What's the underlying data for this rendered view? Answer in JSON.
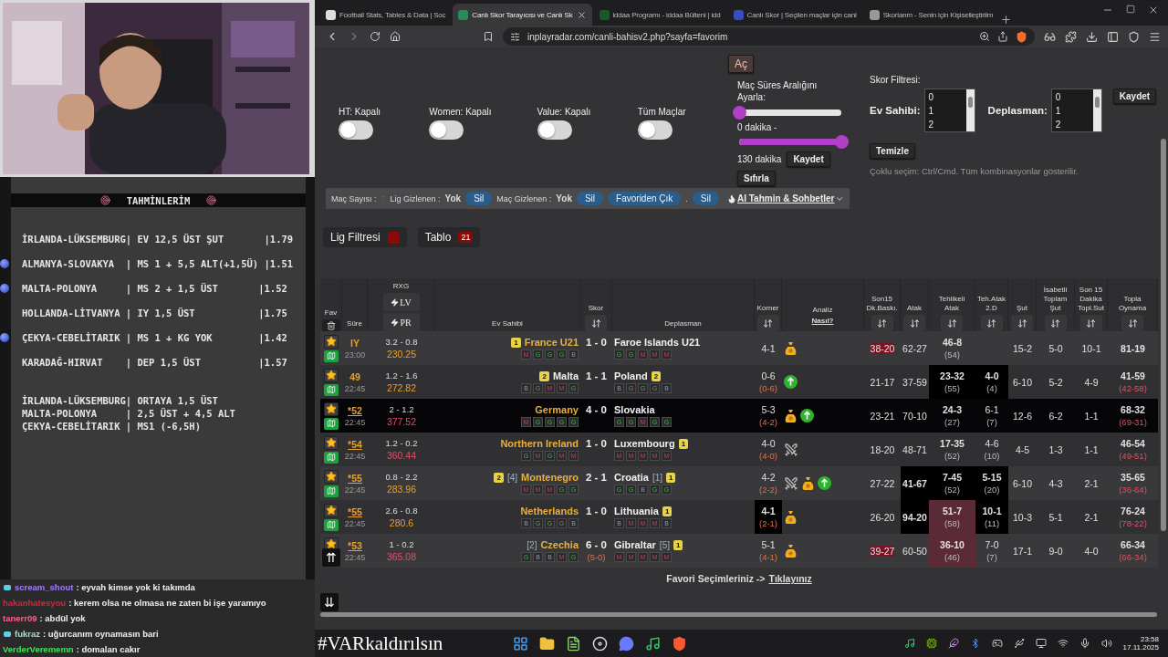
{
  "predictions": {
    "title": "TAHMİNLERİM",
    "lines": [
      {
        "text": "İRLANDA-LÜKSEMBURG| EV 12,5 ÜST ŞUT       |1.79",
        "marked": false
      },
      {
        "text": "ALMANYA-SLOVAKYA  | MS 1 + 5,5 ALT(+1,5Ü) |1.51",
        "marked": true
      },
      {
        "text": "MALTA-POLONYA     | MS 2 + 1,5 ÜST       |1.52",
        "marked": true
      },
      {
        "text": "HOLLANDA-LİTVANYA | IY 1,5 ÜST           |1.75",
        "marked": false
      },
      {
        "text": "ÇEKYA-CEBELİTARIK | MS 1 + KG YOK        |1.42",
        "marked": true
      },
      {
        "text": "KARADAĞ-HIRVAT    | DEP 1,5 ÜST          |1.57",
        "marked": false
      }
    ],
    "extra_lines": [
      "İRLANDA-LÜKSEMBURG| ORTAYA 1,5 ÜST",
      "MALTA-POLONYA     | 2,5 ÜST + 4,5 ALT",
      "ÇEKYA-CEBELİTARIK | MS1 (-6,5H)"
    ]
  },
  "chat": [
    {
      "user": "scream_shout",
      "color": "#a878ff",
      "message": ": eyvah kimse yok ki takımda",
      "badge": true
    },
    {
      "user": "hakanhatesyou",
      "color": "#e0203a",
      "message": ": kerem olsa ne olmasa ne zaten bi işe yaramıyo",
      "badge": false
    },
    {
      "user": "tanerr09",
      "color": "#ff6088",
      "message": ": abdül yok",
      "badge": false
    },
    {
      "user": "fukraz",
      "color": "#9fe0c0",
      "message": ": uğurcanım oynamasın bari",
      "badge": true
    },
    {
      "user": "VerderVerememn",
      "color": "#40e060",
      "message": ": domalan cakır",
      "badge": false
    }
  ],
  "browser": {
    "tabs": [
      {
        "title": "Football Stats, Tables & Data | Soc",
        "selected": false
      },
      {
        "title": "Canlı Skor Tarayıcısı ve Canlı Sk",
        "selected": true
      },
      {
        "title": "iddaa Programı - iddaa Bülteni | idd",
        "selected": false
      },
      {
        "title": "Canlı Skor | Seçilen maçlar için canl",
        "selected": false
      },
      {
        "title": "Skorlarım - Senin için Kişiselleştirilm",
        "selected": false
      }
    ],
    "url": "inplayradar.com/canli-bahisv2.php?sayfa=favorim"
  },
  "controls": {
    "open_button": "Aç",
    "toggles": [
      {
        "label": "HT: Kapalı",
        "on": false
      },
      {
        "label": "Women: Kapalı",
        "on": false
      },
      {
        "label": "Value: Kapalı",
        "on": false
      },
      {
        "label": "Tüm Maçlar",
        "on": false
      }
    ],
    "duration": {
      "label": "Maç Süres Aralığını Ayarla:",
      "min_slider": {
        "level": 0
      },
      "min_reading": "0 dakika -",
      "max_slider": {
        "level": 1
      },
      "max_reading": "130 dakika",
      "save": "Kaydet",
      "reset": "Sıfırla"
    },
    "score_filter": {
      "title": "Skor Filtresi:",
      "home_label": "Ev Sahibi:",
      "home_options": [
        "0",
        "1",
        "2"
      ],
      "away_label": "Deplasman:",
      "away_options": [
        "0",
        "1",
        "2"
      ],
      "save": "Kaydet",
      "clear": "Temizle",
      "hint": "Çoklu seçim: Ctrl/Cmd. Tüm kombinasyonlar gösterilir."
    }
  },
  "info_bar": [
    {
      "kind": "label",
      "text": "Maç Sayısı :"
    },
    {
      "kind": "count",
      "text": "7"
    },
    {
      "kind": "label",
      "text": "Lig Gizlenen :"
    },
    {
      "kind": "value",
      "text": "Yok"
    },
    {
      "kind": "pill",
      "text": "Sil"
    },
    {
      "kind": "label",
      "text": "Maç Gizlenen :"
    },
    {
      "kind": "value",
      "text": "Yok"
    },
    {
      "kind": "pill",
      "text": "Sil"
    },
    {
      "kind": "pill",
      "text": "Favoriden Çık"
    },
    {
      "kind": "label",
      "text": "."
    },
    {
      "kind": "pill",
      "text": "Sil"
    },
    {
      "kind": "menu",
      "text": "AI Tahmin & Sohbetler"
    }
  ],
  "filter_buttons": [
    {
      "label": "Lig Filtresi",
      "kind": "swatch"
    },
    {
      "label": "Tablo",
      "kind": "count",
      "count": "21"
    }
  ],
  "table": {
    "columns": [
      {
        "lines": [
          "Fav"
        ],
        "kind": "trash"
      },
      {
        "lines": [
          "Süre"
        ],
        "kind": "plain"
      },
      {
        "lines": [
          "RXG"
        ],
        "kind": "rxg",
        "buttons": [
          "LV",
          "PR"
        ]
      },
      {
        "lines": [
          "Ev Sahibi"
        ],
        "kind": "plain"
      },
      {
        "lines": [
          "Skor"
        ],
        "kind": "sort"
      },
      {
        "lines": [
          "Deplasman"
        ],
        "kind": "plain"
      },
      {
        "lines": [
          "Korner"
        ],
        "kind": "sort"
      },
      {
        "lines": [
          "Analiz"
        ],
        "kind": "link",
        "link": "Nasıl?"
      },
      {
        "lines": [
          "Son15",
          "Dk.Baskı."
        ],
        "kind": "sort"
      },
      {
        "lines": [
          "Atak"
        ],
        "kind": "sort"
      },
      {
        "lines": [
          "Tehlikeli",
          "Atak"
        ],
        "kind": "sort"
      },
      {
        "lines": [
          "Teh.Atak",
          "2.D"
        ],
        "kind": "sort"
      },
      {
        "lines": [
          "Şut"
        ],
        "kind": "sort"
      },
      {
        "lines": [
          "İsabetli",
          "Toplam",
          "Şut"
        ],
        "kind": "sort"
      },
      {
        "lines": [
          "Son 15",
          "Dakika",
          "Topl.Sut"
        ],
        "kind": "sort"
      },
      {
        "lines": [
          "Topla",
          "Oynama"
        ],
        "kind": "sort"
      }
    ],
    "rows": [
      {
        "minute": "IY",
        "minute_link": false,
        "time": "23:00",
        "rxg": "3.2 - 0.8",
        "rating": {
          "text": "230.25",
          "color": "#e8a030"
        },
        "highlighted": false,
        "home": {
          "name": "France U21",
          "favored": true,
          "badges": [
            {
              "kind": "rank",
              "text": "1"
            }
          ],
          "form": [
            {
              "r": "M",
              "kind": "loss"
            },
            {
              "r": "G",
              "kind": "win"
            },
            {
              "r": "G",
              "kind": "win"
            },
            {
              "r": "G",
              "kind": "win"
            },
            {
              "r": "B",
              "kind": "draw"
            }
          ]
        },
        "score": "1 - 0",
        "away": {
          "name": "Faroe Islands U21",
          "favored": false,
          "form": [
            {
              "r": "G",
              "kind": "win"
            },
            {
              "r": "G",
              "kind": "win"
            },
            {
              "r": "M",
              "kind": "loss"
            },
            {
              "r": "M",
              "kind": "loss"
            },
            {
              "r": "M",
              "kind": "loss"
            }
          ]
        },
        "corner": {
          "v": "4-1",
          "kind": "plain"
        },
        "analysis": [
          {
            "kind": "money"
          }
        ],
        "stats": [
          {
            "v": "38-20",
            "kind": "tag"
          },
          {
            "v": "62-27",
            "kind": "plain"
          },
          {
            "v": "46-8",
            "sub": "(54)",
            "kind": "plain"
          },
          {
            "kind": "plain"
          },
          {
            "v": "15-2",
            "kind": "plain"
          },
          {
            "v": "5-0",
            "kind": "plain"
          },
          {
            "v": "10-1",
            "kind": "plain"
          },
          {
            "v": "81-19",
            "kind": "plain"
          }
        ]
      },
      {
        "minute": "49",
        "minute_link": false,
        "time": "22:45",
        "rxg": "1.2 - 1.6",
        "rating": {
          "text": "272.82",
          "color": "#e8a030"
        },
        "highlighted": false,
        "home": {
          "name": "Malta",
          "favored": false,
          "badges": [
            {
              "kind": "rank",
              "text": "2"
            }
          ],
          "form": [
            {
              "r": "B",
              "kind": "draw"
            },
            {
              "r": "G",
              "kind": "win"
            },
            {
              "r": "M",
              "kind": "loss"
            },
            {
              "r": "M",
              "kind": "loss"
            },
            {
              "r": "G",
              "kind": "win"
            }
          ]
        },
        "score": "1 - 1",
        "away": {
          "name": "Poland",
          "favored": false,
          "badges": [
            {
              "kind": "rank",
              "text": "2"
            }
          ],
          "form": [
            {
              "r": "B",
              "kind": "draw"
            },
            {
              "r": "G",
              "kind": "win"
            },
            {
              "r": "G",
              "kind": "win"
            },
            {
              "r": "G",
              "kind": "win"
            },
            {
              "r": "B",
              "kind": "draw"
            }
          ]
        },
        "corner": {
          "v": "0-6",
          "sub": "(0-6)",
          "kind": "plain"
        },
        "analysis": [
          {
            "kind": "up"
          }
        ],
        "stats": [
          {
            "v": "21-17",
            "kind": "plain"
          },
          {
            "v": "37-59",
            "kind": "plain"
          },
          {
            "v": "23-32",
            "sub": "(55)",
            "kind": "dark"
          },
          {
            "v": "4-0",
            "sub": "(4)",
            "kind": "dark"
          },
          {
            "v": "6-10",
            "kind": "plain"
          },
          {
            "v": "5-2",
            "kind": "plain"
          },
          {
            "v": "4-9",
            "kind": "plain"
          },
          {
            "v": "41-59",
            "sub": "(42-58)",
            "kind": "plain"
          }
        ]
      },
      {
        "minute": "*52",
        "minute_link": true,
        "time": "22:45",
        "rxg": "2 - 1.2",
        "rating": {
          "text": "377.52",
          "color": "#e0506a"
        },
        "highlighted": true,
        "home": {
          "name": "Germany",
          "favored": true,
          "form": [
            {
              "r": "M",
              "kind": "loss"
            },
            {
              "r": "G",
              "kind": "win"
            },
            {
              "r": "G",
              "kind": "win"
            },
            {
              "r": "G",
              "kind": "win"
            },
            {
              "r": "G",
              "kind": "win"
            }
          ]
        },
        "score": "4 - 0",
        "away": {
          "name": "Slovakia",
          "favored": false,
          "form": [
            {
              "r": "G",
              "kind": "win"
            },
            {
              "r": "G",
              "kind": "win"
            },
            {
              "r": "M",
              "kind": "loss"
            },
            {
              "r": "G",
              "kind": "win"
            },
            {
              "r": "G",
              "kind": "win"
            }
          ]
        },
        "corner": {
          "v": "5-3",
          "sub": "(4-2)",
          "kind": "plain"
        },
        "analysis": [
          {
            "kind": "money"
          },
          {
            "kind": "up"
          }
        ],
        "stats": [
          {
            "v": "23-21",
            "kind": "plain"
          },
          {
            "v": "70-10",
            "kind": "plain"
          },
          {
            "v": "24-3",
            "sub": "(27)",
            "kind": "plain"
          },
          {
            "v": "6-1",
            "sub": "(7)",
            "kind": "plain"
          },
          {
            "v": "12-6",
            "kind": "plain"
          },
          {
            "v": "6-2",
            "kind": "plain"
          },
          {
            "v": "1-1",
            "kind": "plain"
          },
          {
            "v": "68-32",
            "sub": "(69-31)",
            "kind": "plain"
          }
        ]
      },
      {
        "minute": "*54",
        "minute_link": true,
        "time": "22:45",
        "rxg": "1.2 - 0.2",
        "rating": {
          "text": "360.44",
          "color": "#e0506a"
        },
        "highlighted": false,
        "home": {
          "name": "Northern Ireland",
          "favored": true,
          "form": [
            {
              "r": "G",
              "kind": "win"
            },
            {
              "r": "M",
              "kind": "loss"
            },
            {
              "r": "G",
              "kind": "win"
            },
            {
              "r": "M",
              "kind": "loss"
            },
            {
              "r": "M",
              "kind": "loss"
            }
          ]
        },
        "score": "1 - 0",
        "away": {
          "name": "Luxembourg",
          "favored": false,
          "badges": [
            {
              "kind": "rank",
              "text": "1"
            }
          ],
          "form": [
            {
              "r": "M",
              "kind": "loss"
            },
            {
              "r": "M",
              "kind": "loss"
            },
            {
              "r": "M",
              "kind": "loss"
            },
            {
              "r": "M",
              "kind": "loss"
            },
            {
              "r": "M",
              "kind": "loss"
            }
          ]
        },
        "corner": {
          "v": "4-0",
          "sub": "(4-0)",
          "kind": "plain"
        },
        "analysis": [
          {
            "kind": "swords"
          }
        ],
        "stats": [
          {
            "v": "18-20",
            "kind": "plain"
          },
          {
            "v": "48-71",
            "kind": "plain"
          },
          {
            "v": "17-35",
            "sub": "(52)",
            "kind": "plain"
          },
          {
            "v": "4-6",
            "sub": "(10)",
            "kind": "plain"
          },
          {
            "v": "4-5",
            "kind": "plain"
          },
          {
            "v": "1-3",
            "kind": "plain"
          },
          {
            "v": "1-1",
            "kind": "plain"
          },
          {
            "v": "46-54",
            "sub": "(49-51)",
            "kind": "plain"
          }
        ]
      },
      {
        "minute": "*55",
        "minute_link": true,
        "time": "22:45",
        "rxg": "0.8 - 2.2",
        "rating": {
          "text": "283.96",
          "color": "#e8a030"
        },
        "highlighted": false,
        "home": {
          "name": "Montenegro",
          "favored": true,
          "badges": [
            {
              "kind": "rank",
              "text": "2"
            },
            {
              "kind": "seed",
              "text": "[4]"
            }
          ],
          "form": [
            {
              "r": "M",
              "kind": "loss"
            },
            {
              "r": "M",
              "kind": "loss"
            },
            {
              "r": "M",
              "kind": "loss"
            },
            {
              "r": "G",
              "kind": "win"
            },
            {
              "r": "G",
              "kind": "win"
            }
          ]
        },
        "score": "2 - 1",
        "away": {
          "name": "Croatia",
          "favored": false,
          "badges": [
            {
              "kind": "seed",
              "text": "[1]"
            },
            {
              "kind": "rank",
              "text": "1"
            }
          ],
          "form": [
            {
              "r": "G",
              "kind": "win"
            },
            {
              "r": "G",
              "kind": "win"
            },
            {
              "r": "B",
              "kind": "draw"
            },
            {
              "r": "G",
              "kind": "win"
            },
            {
              "r": "G",
              "kind": "win"
            }
          ]
        },
        "corner": {
          "v": "4-2",
          "sub": "(2-2)",
          "kind": "plain"
        },
        "analysis": [
          {
            "kind": "swords"
          },
          {
            "kind": "money"
          },
          {
            "kind": "up"
          }
        ],
        "stats": [
          {
            "v": "27-22",
            "kind": "plain"
          },
          {
            "v": "41-67",
            "kind": "dark"
          },
          {
            "v": "7-45",
            "sub": "(52)",
            "kind": "dark"
          },
          {
            "v": "5-15",
            "sub": "(20)",
            "kind": "dark"
          },
          {
            "v": "6-10",
            "kind": "plain"
          },
          {
            "v": "4-3",
            "kind": "plain"
          },
          {
            "v": "2-1",
            "kind": "plain"
          },
          {
            "v": "35-65",
            "sub": "(36-64)",
            "kind": "plain"
          }
        ]
      },
      {
        "minute": "*55",
        "minute_link": true,
        "time": "22:45",
        "rxg": "2.6 - 0.8",
        "rating": {
          "text": "280.6",
          "color": "#e8a030"
        },
        "highlighted": false,
        "home": {
          "name": "Netherlands",
          "favored": true,
          "form": [
            {
              "r": "B",
              "kind": "draw"
            },
            {
              "r": "G",
              "kind": "win"
            },
            {
              "r": "G",
              "kind": "win"
            },
            {
              "r": "G",
              "kind": "win"
            },
            {
              "r": "B",
              "kind": "draw"
            }
          ]
        },
        "score": "1 - 0",
        "away": {
          "name": "Lithuania",
          "favored": false,
          "badges": [
            {
              "kind": "rank",
              "text": "1"
            }
          ],
          "form": [
            {
              "r": "B",
              "kind": "draw"
            },
            {
              "r": "M",
              "kind": "loss"
            },
            {
              "r": "M",
              "kind": "loss"
            },
            {
              "r": "M",
              "kind": "loss"
            },
            {
              "r": "B",
              "kind": "draw"
            }
          ]
        },
        "corner": {
          "v": "4-1",
          "sub": "(2-1)",
          "kind": "dark"
        },
        "analysis": [
          {
            "kind": "money"
          }
        ],
        "stats": [
          {
            "v": "26-20",
            "kind": "plain"
          },
          {
            "v": "94-20",
            "kind": "dark"
          },
          {
            "v": "51-7",
            "sub": "(58)",
            "kind": "red"
          },
          {
            "v": "10-1",
            "sub": "(11)",
            "kind": "dark"
          },
          {
            "v": "10-3",
            "kind": "plain"
          },
          {
            "v": "5-1",
            "kind": "plain"
          },
          {
            "v": "2-1",
            "kind": "plain"
          },
          {
            "v": "76-24",
            "sub": "(78-22)",
            "kind": "plain"
          }
        ]
      },
      {
        "minute": "*53",
        "minute_link": true,
        "time": "22:45",
        "rxg": "1 - 0.2",
        "rating": {
          "text": "365.08",
          "color": "#e0506a"
        },
        "highlighted": false,
        "home": {
          "name": "Czechia",
          "favored": true,
          "badges": [
            {
              "kind": "seed",
              "text": "[2]"
            }
          ],
          "form": [
            {
              "r": "G",
              "kind": "win"
            },
            {
              "r": "B",
              "kind": "draw"
            },
            {
              "r": "B",
              "kind": "draw"
            },
            {
              "r": "M",
              "kind": "loss"
            },
            {
              "r": "G",
              "kind": "win"
            }
          ]
        },
        "score": "6 - 0",
        "score_ht": "(5-0)",
        "away": {
          "name": "Gibraltar",
          "favored": false,
          "badges": [
            {
              "kind": "seed",
              "text": "[5]"
            },
            {
              "kind": "rank",
              "text": "1"
            }
          ],
          "form": [
            {
              "r": "M",
              "kind": "loss"
            },
            {
              "r": "M",
              "kind": "loss"
            },
            {
              "r": "M",
              "kind": "loss"
            },
            {
              "r": "M",
              "kind": "loss"
            },
            {
              "r": "M",
              "kind": "loss"
            }
          ]
        },
        "corner": {
          "v": "5-1",
          "sub": "(4-1)",
          "kind": "plain"
        },
        "analysis": [
          {
            "kind": "money"
          }
        ],
        "stats": [
          {
            "v": "39-27",
            "kind": "tag"
          },
          {
            "v": "60-50",
            "kind": "plain"
          },
          {
            "v": "36-10",
            "sub": "(46)",
            "kind": "red"
          },
          {
            "v": "7-0",
            "sub": "(7)",
            "kind": "plain"
          },
          {
            "v": "17-1",
            "kind": "plain"
          },
          {
            "v": "9-0",
            "kind": "plain"
          },
          {
            "v": "4-0",
            "kind": "plain"
          },
          {
            "v": "66-34",
            "sub": "(66-34)",
            "kind": "plain"
          }
        ]
      }
    ]
  },
  "footer": {
    "text": "Favori Seçimleriniz ->",
    "link": "Tıklayınız"
  },
  "scroll_top_button": "⇈",
  "scroll_bottom_button": "⇊",
  "taskbar": {
    "hashtag": "#VARkaldırılsın",
    "time": "23:58",
    "date": "17.11.2025"
  }
}
